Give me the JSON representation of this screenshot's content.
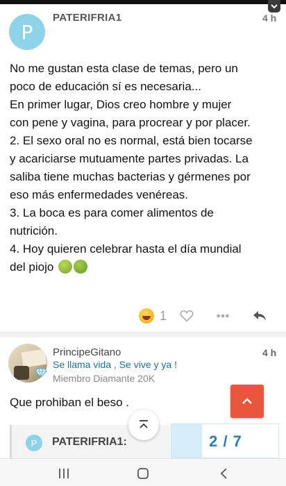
{
  "post1": {
    "author": "PATERIFRIA1",
    "avatar_letter": "P",
    "time": "4 h",
    "lines": [
      "No me gustan esta clase de temas, pero un",
      "poco de educación sí es necesaria...",
      "En primer lugar, Dios creo hombre y mujer",
      "con pene y vagina, para procrear y por placer.",
      "2. El sexo oral no es normal, está bien tocarse",
      "y acariciarse mutuamente partes privadas. La",
      "saliba tiene muchas bacterias y gérmenes por",
      "eso más enfermedades venéreas.",
      "3. La boca es para comer alimentos de",
      "nutrición.",
      "4. Hoy quieren celebrar hasta el día mundial",
      "del piojo"
    ],
    "reactions": {
      "laugh_icon": "laughing-emoji-icon",
      "count": "1",
      "heart_icon": "heart-outline-icon",
      "more_icon": "more-dots-icon",
      "reply_icon": "reply-arrow-icon"
    }
  },
  "post2": {
    "author": "PrincipeGitano",
    "time": "4 h",
    "subtitle": "Se llama vida , Se vive y ya !",
    "member": "Miembro Diamante 20K",
    "body": "Que prohiban el beso ."
  },
  "quote": {
    "avatar_letter": "P",
    "name": "PATERIFRIA1:"
  },
  "pagination": {
    "label": "2 / 7",
    "current": 2,
    "total": 7
  },
  "colors": {
    "accent_orange": "#e8553c",
    "avatar_blue": "#8fd3ea",
    "subtitle_blue": "#1f6f93",
    "page_blue": "#2a7fb0"
  }
}
